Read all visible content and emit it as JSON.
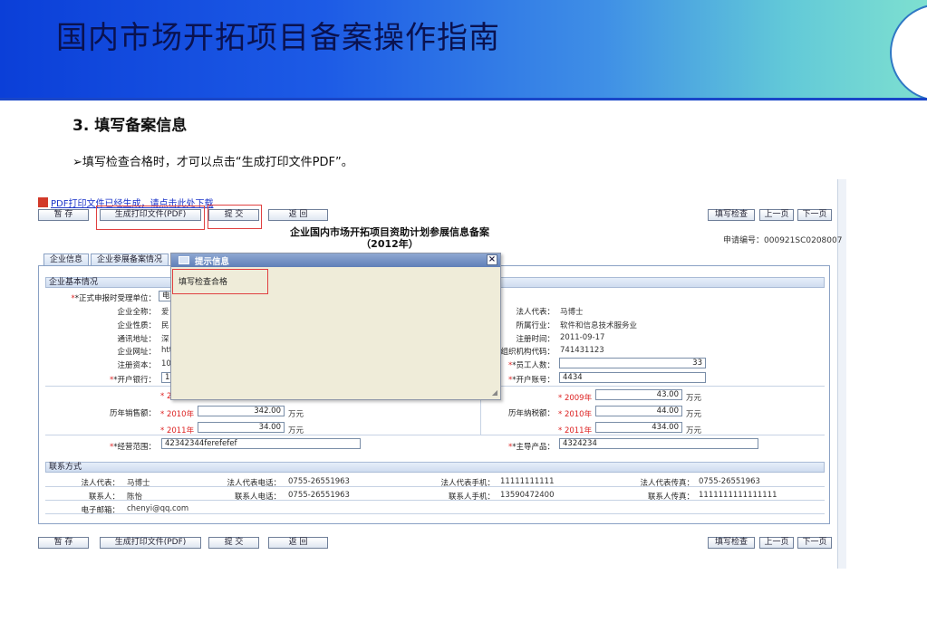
{
  "slide": {
    "title": "国内市场开拓项目备案操作指南",
    "section": "3.  填写备案信息",
    "bullet": "➢填写检查合格时，才可以点击“生成打印文件PDF”。"
  },
  "app": {
    "pdf_link": "PDF打印文件已经生成，请点击此处下载",
    "buttons": {
      "save": "暂 存",
      "gen_pdf": "生成打印文件(PDF)",
      "submit": "提 交",
      "back": "返 回",
      "check": "填写检查",
      "prev": "上一页",
      "next": "下一页"
    },
    "form_title": "企业国内市场开拓项目资助计划参展信息备案",
    "form_year": "（2012年）",
    "app_no_label": "申请编号：",
    "app_no": "000921SC0208007",
    "tabs": [
      "企业信息",
      "企业参展备案情况"
    ],
    "dialog": {
      "title": "提示信息",
      "close": "×",
      "message": "填写检查合格"
    },
    "basic": {
      "title": "企业基本情况",
      "left_labels": [
        "*正式申报时受理单位：",
        "企业全称：",
        "企业性质：",
        "通讯地址：",
        "企业网址：",
        "注册资本：",
        "*开户银行："
      ],
      "left_values": [
        "电",
        "爱",
        "民",
        "深",
        "htt",
        "10",
        "1"
      ],
      "right_labels": [
        "法人代表：",
        "所属行业：",
        "注册时间：",
        "组织机构代码：",
        "*员工人数：",
        "*开户账号："
      ],
      "right_values": [
        "马博士",
        "软件和信息技术服务业",
        "2011-09-17",
        "741431123",
        "33",
        "4434"
      ],
      "sales_label": "历年销售额：",
      "sales_partial": "* 2",
      "sales": [
        {
          "year": "* 2010年",
          "value": "342.00",
          "unit": "万元"
        },
        {
          "year": "* 2011年",
          "value": "34.00",
          "unit": "万元"
        }
      ],
      "tax_label": "历年纳税额：",
      "tax": [
        {
          "year": "* 2009年",
          "value": "43.00",
          "unit": "万元"
        },
        {
          "year": "* 2010年",
          "value": "44.00",
          "unit": "万元"
        },
        {
          "year": "* 2011年",
          "value": "434.00",
          "unit": "万元"
        }
      ],
      "scope_label": "*经营范围：",
      "scope_value": "42342344ferefefef",
      "product_label": "*主导产品：",
      "product_value": "4324234"
    },
    "contact": {
      "title": "联系方式",
      "rows": [
        [
          "法人代表：",
          "马博士",
          "法人代表电话：",
          "0755-26551963",
          "法人代表手机：",
          "11111111111",
          "法人代表传真：",
          "0755-26551963"
        ],
        [
          "联系人：",
          "陈怡",
          "联系人电话：",
          "0755-26551963",
          "联系人手机：",
          "13590472400",
          "联系人传真：",
          "1111111111111111"
        ],
        [
          "电子邮箱：",
          "chenyi@qq.com",
          "",
          "",
          "",
          "",
          "",
          ""
        ]
      ]
    }
  }
}
